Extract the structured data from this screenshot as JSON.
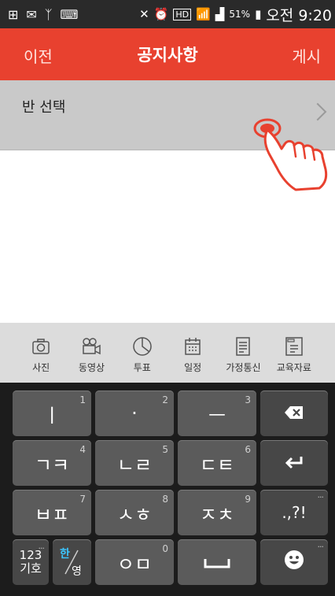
{
  "status_bar": {
    "battery": "51%",
    "time": "오전 9:20",
    "icons": [
      "add-icon",
      "mail-icon",
      "usb-icon",
      "keyboard-icon",
      "mute-icon",
      "alarm-icon",
      "hd-voice-icon",
      "wifi-icon",
      "signal-icon",
      "battery-icon"
    ]
  },
  "header": {
    "back_label": "이전",
    "title": "공지사항",
    "post_label": "게시",
    "color": "#e8412f"
  },
  "class_select": {
    "label": "반 선택"
  },
  "attachments": [
    {
      "label": "사진",
      "icon": "camera-icon"
    },
    {
      "label": "동영상",
      "icon": "video-camera-icon"
    },
    {
      "label": "투표",
      "icon": "pie-chart-icon"
    },
    {
      "label": "일정",
      "icon": "calendar-icon"
    },
    {
      "label": "가정통신",
      "icon": "document-icon"
    },
    {
      "label": "교육자료",
      "icon": "folder-icon"
    }
  ],
  "keyboard": {
    "row1": [
      {
        "label": "ㅣ",
        "num": "1"
      },
      {
        "label": "·",
        "num": "2"
      },
      {
        "label": "ㅡ",
        "num": "3"
      }
    ],
    "row2": [
      {
        "label": "ㄱㅋ",
        "num": "4"
      },
      {
        "label": "ㄴㄹ",
        "num": "5"
      },
      {
        "label": "ㄷㅌ",
        "num": "6"
      }
    ],
    "row3": [
      {
        "label": "ㅂㅍ",
        "num": "7"
      },
      {
        "label": "ㅅㅎ",
        "num": "8"
      },
      {
        "label": "ㅈㅊ",
        "num": "9"
      }
    ],
    "row4": [
      {
        "label": "ㅇㅁ",
        "num": "0"
      }
    ],
    "punct_label": ".,?!",
    "symbol_label_top": "123",
    "symbol_label_bottom": "기호",
    "lang_label_top": "한",
    "lang_label_bottom": "영",
    "more": "..."
  }
}
